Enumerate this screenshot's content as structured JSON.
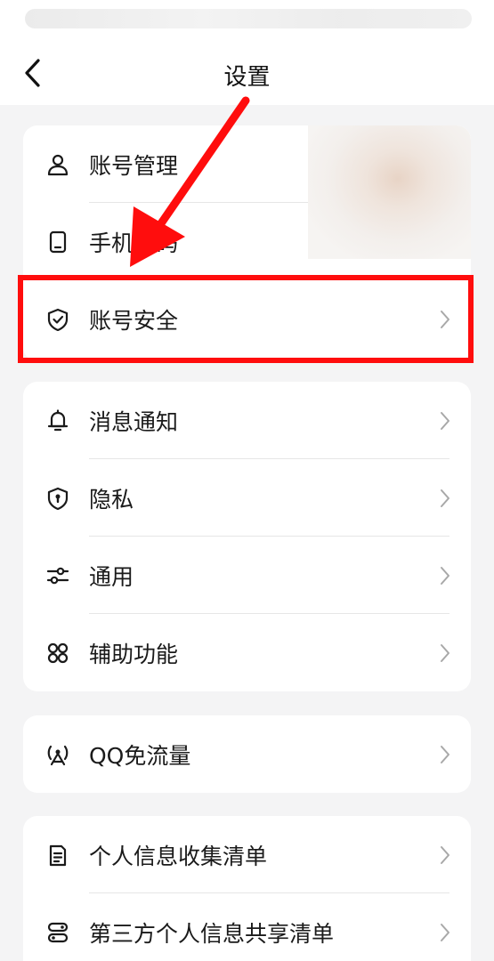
{
  "nav": {
    "title": "设置"
  },
  "groups": [
    {
      "items": [
        {
          "label": "账号管理",
          "icon": "person-icon"
        },
        {
          "label": "手机号码",
          "icon": "phone-icon"
        },
        {
          "label": "账号安全",
          "icon": "shield-check-icon"
        }
      ]
    },
    {
      "items": [
        {
          "label": "消息通知",
          "icon": "bell-icon"
        },
        {
          "label": "隐私",
          "icon": "privacy-shield-icon"
        },
        {
          "label": "通用",
          "icon": "sliders-icon"
        },
        {
          "label": "辅助功能",
          "icon": "apps-grid-icon"
        }
      ]
    },
    {
      "items": [
        {
          "label": "QQ免流量",
          "icon": "signal-tower-icon"
        }
      ]
    },
    {
      "items": [
        {
          "label": "个人信息收集清单",
          "icon": "document-icon"
        },
        {
          "label": "第三方个人信息共享清单",
          "icon": "share-list-icon"
        }
      ]
    }
  ],
  "colors": {
    "highlight": "#ff0d0d",
    "background": "#f4f4f5",
    "card": "#ffffff"
  }
}
